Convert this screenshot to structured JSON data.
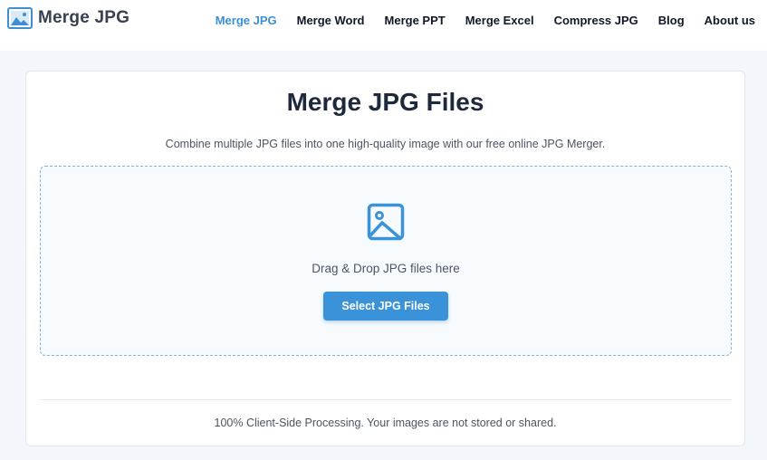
{
  "header": {
    "brand": "Merge JPG",
    "brand_icon": "image-gallery-icon",
    "nav": [
      {
        "label": "Merge JPG",
        "active": true
      },
      {
        "label": "Merge Word",
        "active": false
      },
      {
        "label": "Merge PPT",
        "active": false
      },
      {
        "label": "Merge Excel",
        "active": false
      },
      {
        "label": "Compress JPG",
        "active": false
      },
      {
        "label": "Blog",
        "active": false
      },
      {
        "label": "About us",
        "active": false
      }
    ]
  },
  "main": {
    "title": "Merge JPG Files",
    "subtitle": "Combine multiple JPG files into one high-quality image with our free online JPG Merger.",
    "dropzone": {
      "icon": "image-icon",
      "text": "Drag & Drop JPG files here",
      "button_label": "Select JPG Files"
    },
    "footnote": "100% Client-Side Processing. Your images are not stored or shared."
  },
  "colors": {
    "accent": "#3a93d8",
    "active_nav": "#3b8fd6",
    "text_dark": "#1e293b",
    "background": "#f3f7fb"
  }
}
